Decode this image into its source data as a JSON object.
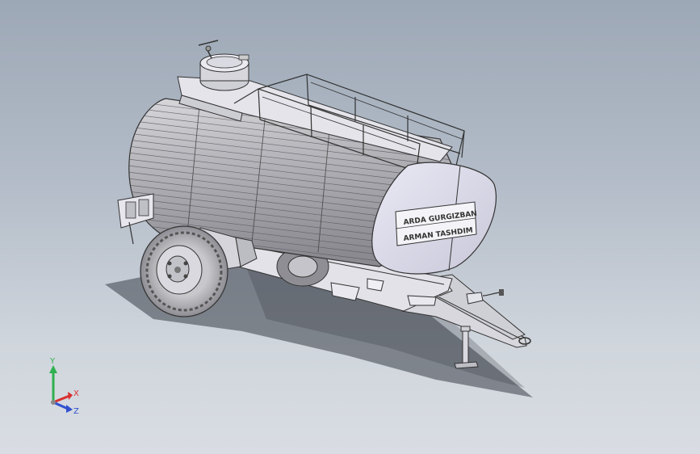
{
  "viewport": {
    "model": "water tanker trailer",
    "tank_plate": {
      "line1": "ARDA GURGIZBAN",
      "line2": "ARMAN TASHDIM"
    }
  },
  "triad": {
    "x_label": "X",
    "y_label": "Y",
    "z_label": "Z",
    "colors": {
      "x": "#d93030",
      "y": "#30b050",
      "z": "#3050d0"
    }
  }
}
